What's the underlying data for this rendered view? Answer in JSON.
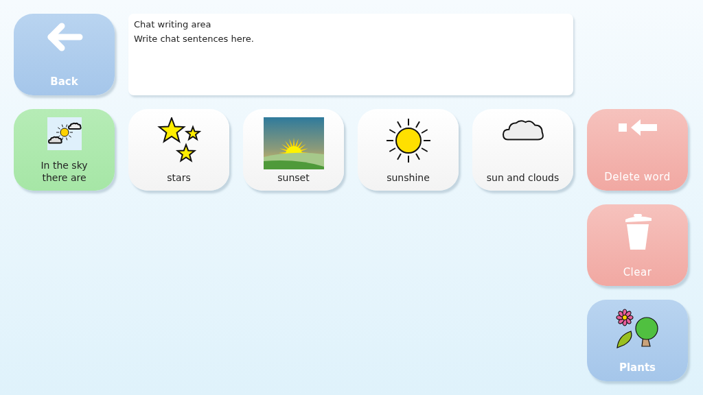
{
  "back_button": {
    "label": "Back"
  },
  "chat_area": {
    "lines": [
      "Chat writing area",
      "Write chat sentences here."
    ]
  },
  "tiles": [
    {
      "kind": "category",
      "label": "In the sky there are"
    },
    {
      "kind": "word",
      "label": "stars"
    },
    {
      "kind": "word",
      "label": "sunset"
    },
    {
      "kind": "word",
      "label": "sunshine"
    },
    {
      "kind": "word",
      "label": "sun and clouds"
    }
  ],
  "actions": [
    {
      "kind": "delete",
      "label": "Delete word"
    },
    {
      "kind": "clear",
      "label": "Clear"
    },
    {
      "kind": "folder",
      "label": "Plants"
    }
  ]
}
